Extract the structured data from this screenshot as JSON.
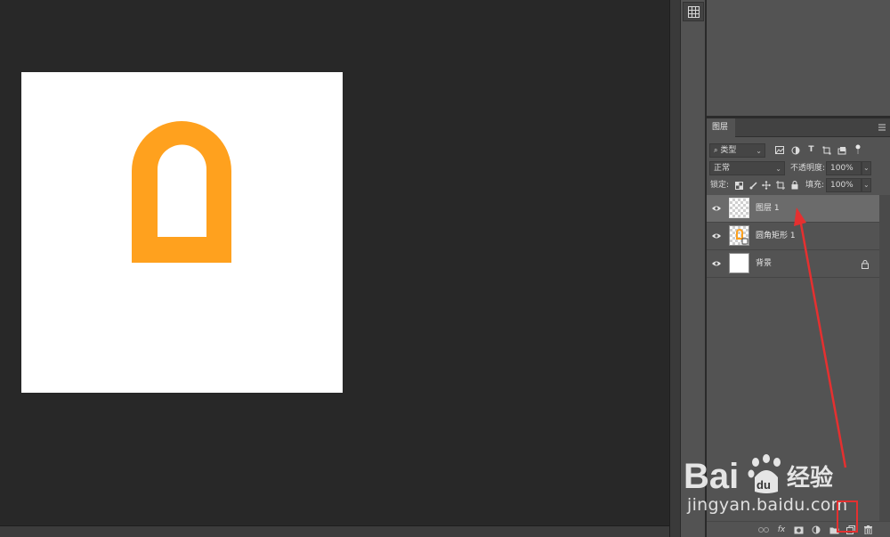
{
  "colors": {
    "shape": "#ffa11e",
    "annotation": "#e53030",
    "panel_bg": "#535353",
    "canvas_bg": "#282828"
  },
  "layers_panel": {
    "tab_title": "图层",
    "filter_kind": "类型",
    "blend_mode": "正常",
    "opacity_label": "不透明度:",
    "opacity_value": "100%",
    "lock_label": "锁定:",
    "fill_label": "填充:",
    "fill_value": "100%",
    "layers": [
      {
        "name": "图层 1",
        "selected": true,
        "visible": true
      },
      {
        "name": "圆角矩形 1",
        "selected": false,
        "visible": true
      },
      {
        "name": "背景",
        "selected": false,
        "visible": true,
        "locked": true
      }
    ]
  },
  "watermark": {
    "url": "jingyan.baidu.com"
  }
}
